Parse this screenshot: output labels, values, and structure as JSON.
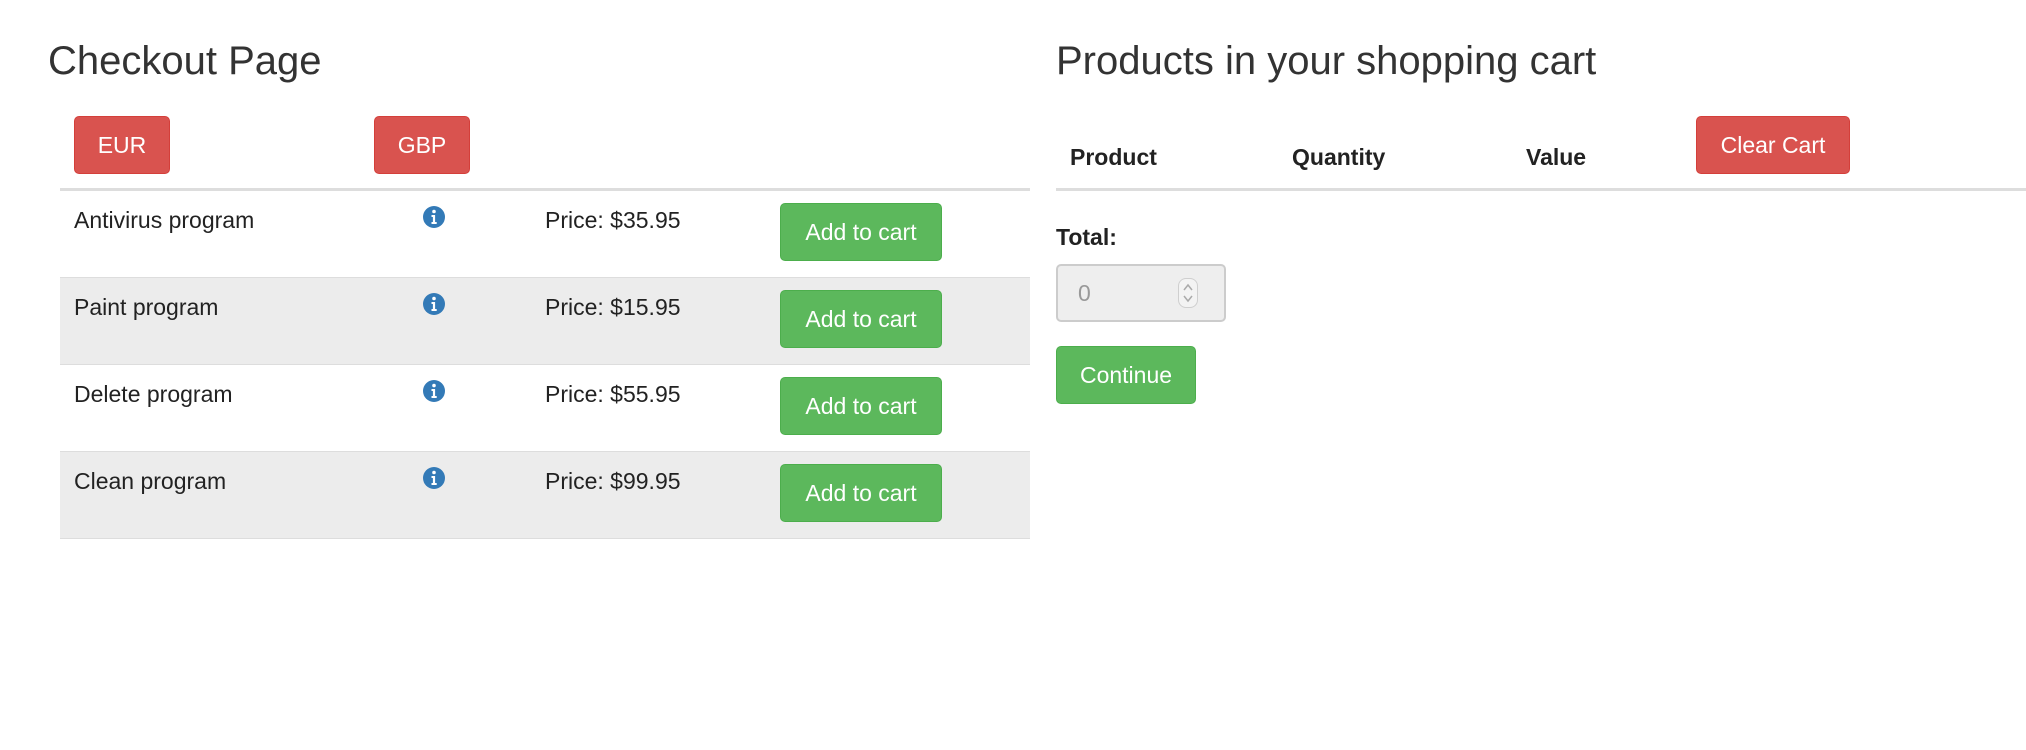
{
  "page_title": "Checkout Page",
  "currency_buttons": {
    "eur": "EUR",
    "gbp": "GBP"
  },
  "products": [
    {
      "name": "Antivirus program",
      "price": "Price: $35.95",
      "add_label": "Add to cart",
      "info_icon": "info-circle-icon"
    },
    {
      "name": "Paint program",
      "price": "Price: $15.95",
      "add_label": "Add to cart",
      "info_icon": "info-circle-icon"
    },
    {
      "name": "Delete program",
      "price": "Price: $55.95",
      "add_label": "Add to cart",
      "info_icon": "info-circle-icon"
    },
    {
      "name": "Clean program",
      "price": "Price: $99.95",
      "add_label": "Add to cart",
      "info_icon": "info-circle-icon"
    }
  ],
  "cart": {
    "title": "Products in your shopping cart",
    "columns": {
      "product": "Product",
      "quantity": "Quantity",
      "value": "Value"
    },
    "clear_label": "Clear Cart",
    "total_label": "Total:",
    "total_value": "0",
    "continue_label": "Continue"
  },
  "colors": {
    "danger": "#d9534f",
    "success": "#5cb85c",
    "info_icon": "#337ab7",
    "stripe": "#ececec"
  }
}
